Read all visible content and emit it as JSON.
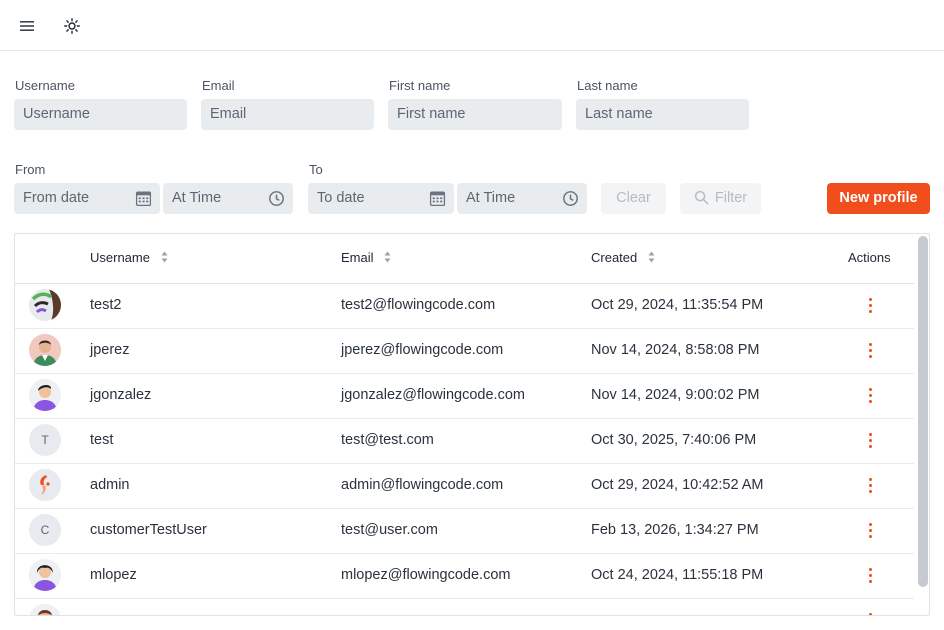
{
  "toolbar": {
    "menu_icon": "hamburger-menu-icon",
    "theme_icon": "sun-icon"
  },
  "filters": {
    "username": {
      "label": "Username",
      "placeholder": "Username"
    },
    "email": {
      "label": "Email",
      "placeholder": "Email"
    },
    "first_name": {
      "label": "First name",
      "placeholder": "First name"
    },
    "last_name": {
      "label": "Last name",
      "placeholder": "Last name"
    },
    "from": {
      "label": "From",
      "date_placeholder": "From date",
      "time_placeholder": "At Time"
    },
    "to": {
      "label": "To",
      "date_placeholder": "To date",
      "time_placeholder": "At Time"
    },
    "clear_label": "Clear",
    "filter_label": "Filter",
    "new_profile_label": "New profile"
  },
  "grid": {
    "columns": {
      "username": "Username",
      "email": "Email",
      "created": "Created",
      "actions": "Actions"
    },
    "rows": [
      {
        "avatar": "image",
        "username": "test2",
        "email": "test2@flowingcode.com",
        "created": "Oct 29, 2024, 11:35:54 PM"
      },
      {
        "avatar": "image",
        "username": "jperez",
        "email": "jperez@flowingcode.com",
        "created": "Nov 14, 2024, 8:58:08 PM"
      },
      {
        "avatar": "image",
        "username": "jgonzalez",
        "email": "jgonzalez@flowingcode.com",
        "created": "Nov 14, 2024, 9:00:02 PM"
      },
      {
        "avatar": "T",
        "username": "test",
        "email": "test@test.com",
        "created": "Oct 30, 2025, 7:40:06 PM"
      },
      {
        "avatar": "image",
        "username": "admin",
        "email": "admin@flowingcode.com",
        "created": "Oct 29, 2024, 10:42:52 AM"
      },
      {
        "avatar": "C",
        "username": "customerTestUser",
        "email": "test@user.com",
        "created": "Feb 13, 2026, 1:34:27 PM"
      },
      {
        "avatar": "image",
        "username": "mlopez",
        "email": "mlopez@flowingcode.com",
        "created": "Oct 24, 2024, 11:55:18 PM"
      }
    ]
  },
  "colors": {
    "accent": "#f04e1c",
    "input_bg": "#e9ecef"
  }
}
